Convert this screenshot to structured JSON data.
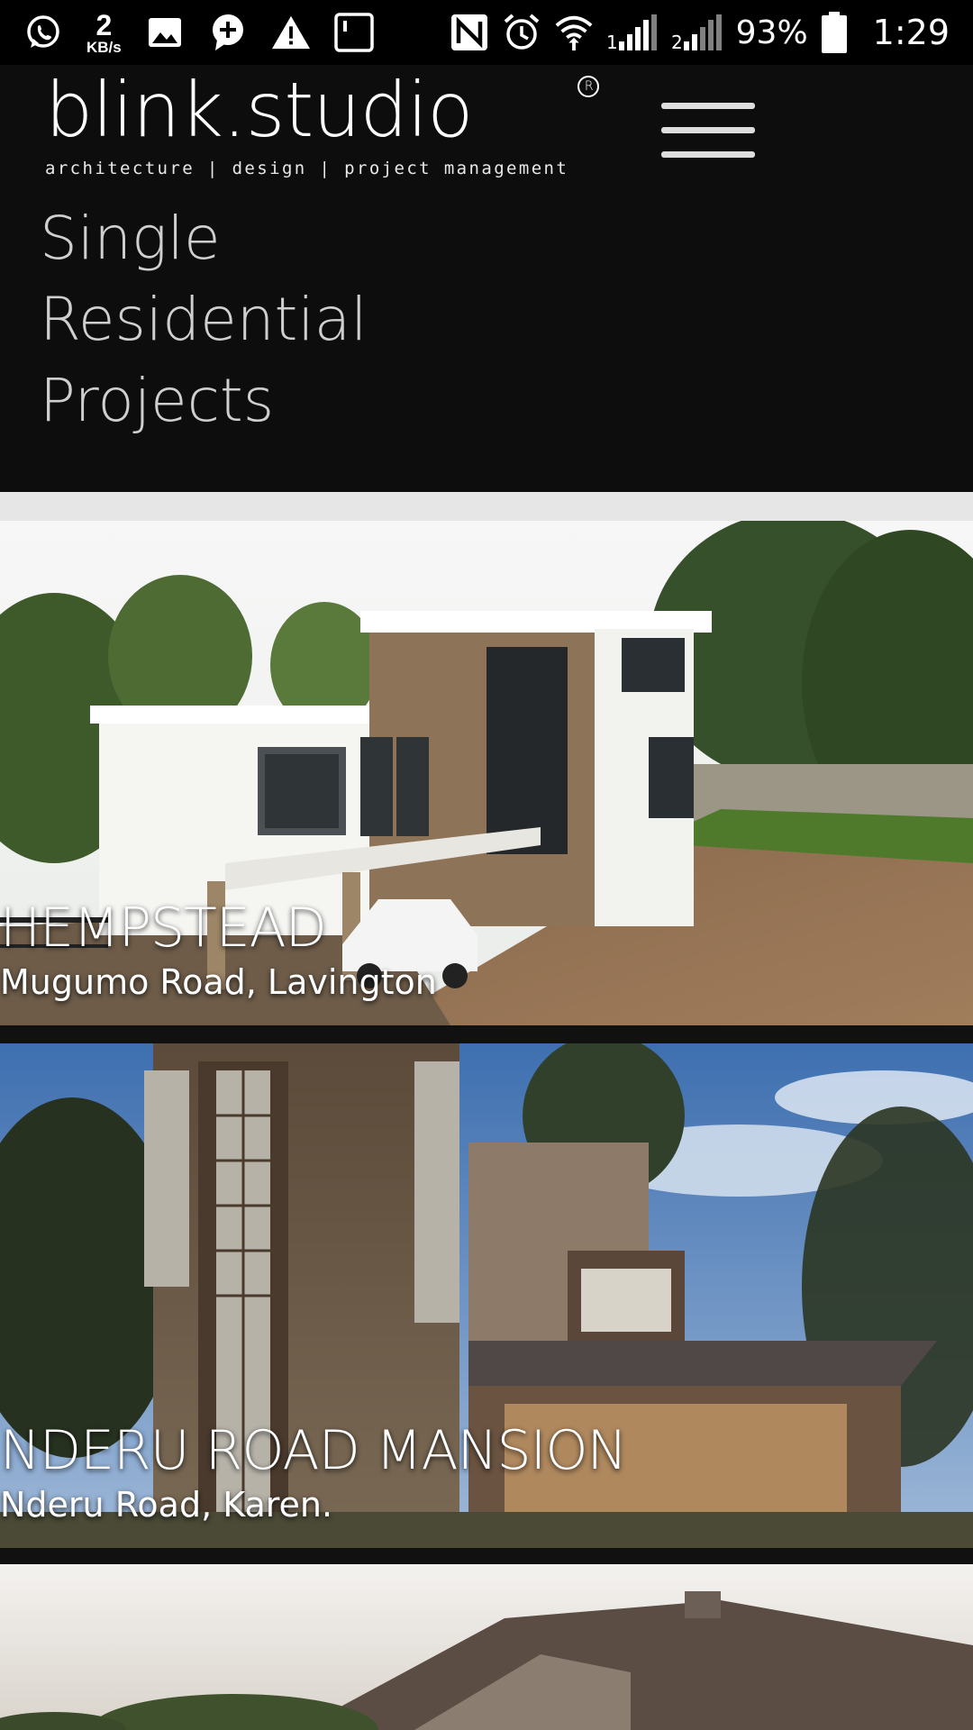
{
  "status_bar": {
    "data_rate_value": "2",
    "data_rate_unit": "KB/s",
    "sim1_label": "1",
    "sim2_label": "2",
    "battery": "93%",
    "time": "1:29",
    "icons": [
      "whatsapp-icon",
      "image-icon",
      "message-plus-icon",
      "warning-icon",
      "nfc-square-icon",
      "nfc-icon",
      "alarm-icon",
      "wifi-icon",
      "signal-icon",
      "battery-icon"
    ]
  },
  "header": {
    "logo_text": "blink.studio",
    "logo_tagline": "architecture | design | project management",
    "menu_icon": "hamburger-menu-icon",
    "title_lines": [
      "Single",
      "Residential",
      "Projects"
    ]
  },
  "projects": [
    {
      "name": "HEMPSTEAD",
      "location": "Mugumo Road, Lavington"
    },
    {
      "name": "NDERU ROAD MANSION",
      "location": "Nderu Road, Karen."
    },
    {
      "name": "",
      "location": ""
    }
  ],
  "colors": {
    "header_bg": "#0d0d0d",
    "title_text": "#cfcfcf",
    "band": "#e6e6e6",
    "status_bg": "#000000"
  }
}
